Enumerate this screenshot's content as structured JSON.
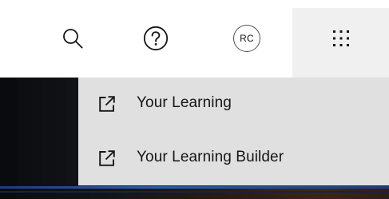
{
  "header": {
    "search_icon": "search-icon",
    "help_icon": "help-icon",
    "avatar_initials": "RC",
    "apps_icon": "app-switcher-icon"
  },
  "app_menu": {
    "items": [
      {
        "label": "Your Learning",
        "icon": "launch-icon"
      },
      {
        "label": "Your Learning Builder",
        "icon": "launch-icon"
      }
    ]
  },
  "colors": {
    "header_bg": "#ffffff",
    "active_button_bg": "#f0f0f0",
    "menu_bg": "#e0e0e0",
    "text": "#161616",
    "icon": "#161616"
  }
}
